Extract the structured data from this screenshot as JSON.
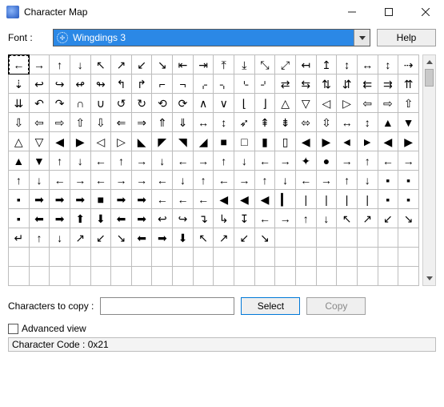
{
  "window": {
    "title": "Character Map"
  },
  "font": {
    "label": "Font :",
    "selected": "Wingdings 3",
    "help_label": "Help"
  },
  "grid": {
    "cols": 20,
    "rows": 12,
    "chars": [
      "←",
      "→",
      "↑",
      "↓",
      "↖",
      "↗",
      "↙",
      "↘",
      "⇤",
      "⇥",
      "⤒",
      "⤓",
      "⤡",
      "⤢",
      "↤",
      "↥",
      "↕",
      "↔",
      "↕",
      "⇢",
      "⇣",
      "↩",
      "↪",
      "↫",
      "↬",
      "↰",
      "↱",
      "⌐",
      "¬",
      "⌌",
      "⌍",
      "⌎",
      "⌏",
      "⇄",
      "⇆",
      "⇅",
      "⇵",
      "⇇",
      "⇉",
      "⇈",
      "⇊",
      "↶",
      "↷",
      "∩",
      "∪",
      "↺",
      "↻",
      "⟲",
      "⟳",
      "∧",
      "∨",
      "⌊",
      "⌋",
      "△",
      "▽",
      "◁",
      "▷",
      "⇦",
      "⇨",
      "⇧",
      "⇩",
      "⇦",
      "⇨",
      "⇧",
      "⇩",
      "⇐",
      "⇒",
      "⇑",
      "⇓",
      "↔",
      "↕",
      "➶",
      "⇞",
      "⇟",
      "⬄",
      "⇳",
      "↔",
      "↕",
      "▲",
      "▼",
      "△",
      "▽",
      "◀",
      "▶",
      "◁",
      "▷",
      "◣",
      "◤",
      "◥",
      "◢",
      "■",
      "□",
      "▮",
      "▯",
      "◀",
      "▶",
      "◄",
      "►",
      "◀",
      "▶",
      "▲",
      "▼",
      "↑",
      "↓",
      "←",
      "↑",
      "→",
      "↓",
      "←",
      "→",
      "↑",
      "↓",
      "←",
      "→",
      "✦",
      "●",
      "→",
      "↑",
      "←",
      "→",
      "↑",
      "↓",
      "←",
      "→",
      "←",
      "→",
      "→",
      "←",
      "↓",
      "↑",
      "←",
      "→",
      "↑",
      "↓",
      "←",
      "→",
      "↑",
      "↓",
      "▪",
      "▪",
      "▪",
      "➡",
      "➡",
      "➡",
      "■",
      "➡",
      "➡",
      "←",
      "←",
      "←",
      "◀",
      "◀",
      "◀",
      "▎",
      "|",
      "|",
      "|",
      "|",
      "▪",
      "▪",
      "▪",
      "⬅",
      "➡",
      "⬆",
      "⬇",
      "⬅",
      "➡",
      "↩",
      "↪",
      "↴",
      "↳",
      "↧",
      "←",
      "→",
      "↑",
      "↓",
      "↖",
      "↗",
      "↙",
      "↘",
      "↵",
      "↑",
      "↓",
      "↗",
      "↙",
      "↘",
      "⬅",
      "➡",
      "⬇",
      "↖",
      "↗",
      "↙",
      "↘"
    ]
  },
  "copy": {
    "label": "Characters to copy :",
    "value": "",
    "select_label": "Select",
    "copy_label": "Copy"
  },
  "advanced": {
    "checked": false,
    "label": "Advanced view"
  },
  "status": {
    "text": "Character Code : 0x21"
  }
}
